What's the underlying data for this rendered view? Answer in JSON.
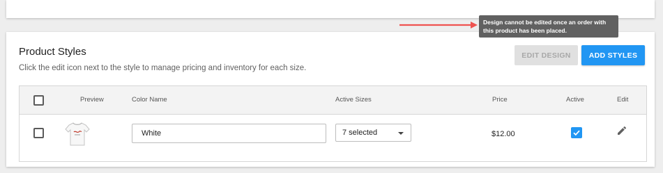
{
  "tooltip": {
    "line1": "Design cannot be edited once an order with",
    "line2": "this product has been placed."
  },
  "product_styles": {
    "title": "Product Styles",
    "subtitle": "Click the edit icon next to the style to manage pricing and inventory for each size.",
    "edit_design_label": "EDIT DESIGN",
    "add_styles_label": "ADD STYLES",
    "columns": {
      "preview": "Preview",
      "color_name": "Color Name",
      "active_sizes": "Active Sizes",
      "price": "Price",
      "active": "Active",
      "edit": "Edit"
    },
    "rows": [
      {
        "color_name": "White",
        "active_sizes": "7 selected",
        "price": "$12.00",
        "active": true,
        "selected": false
      }
    ]
  },
  "colors": {
    "accent": "#2196f3",
    "disabled_button": "#e0e0e0",
    "tooltip_bg": "#616161",
    "arrow": "#ef5350"
  },
  "icons": {
    "edit": "pencil-icon",
    "caret": "caret-down-icon",
    "check": "check-icon",
    "preview": "tshirt-icon"
  }
}
